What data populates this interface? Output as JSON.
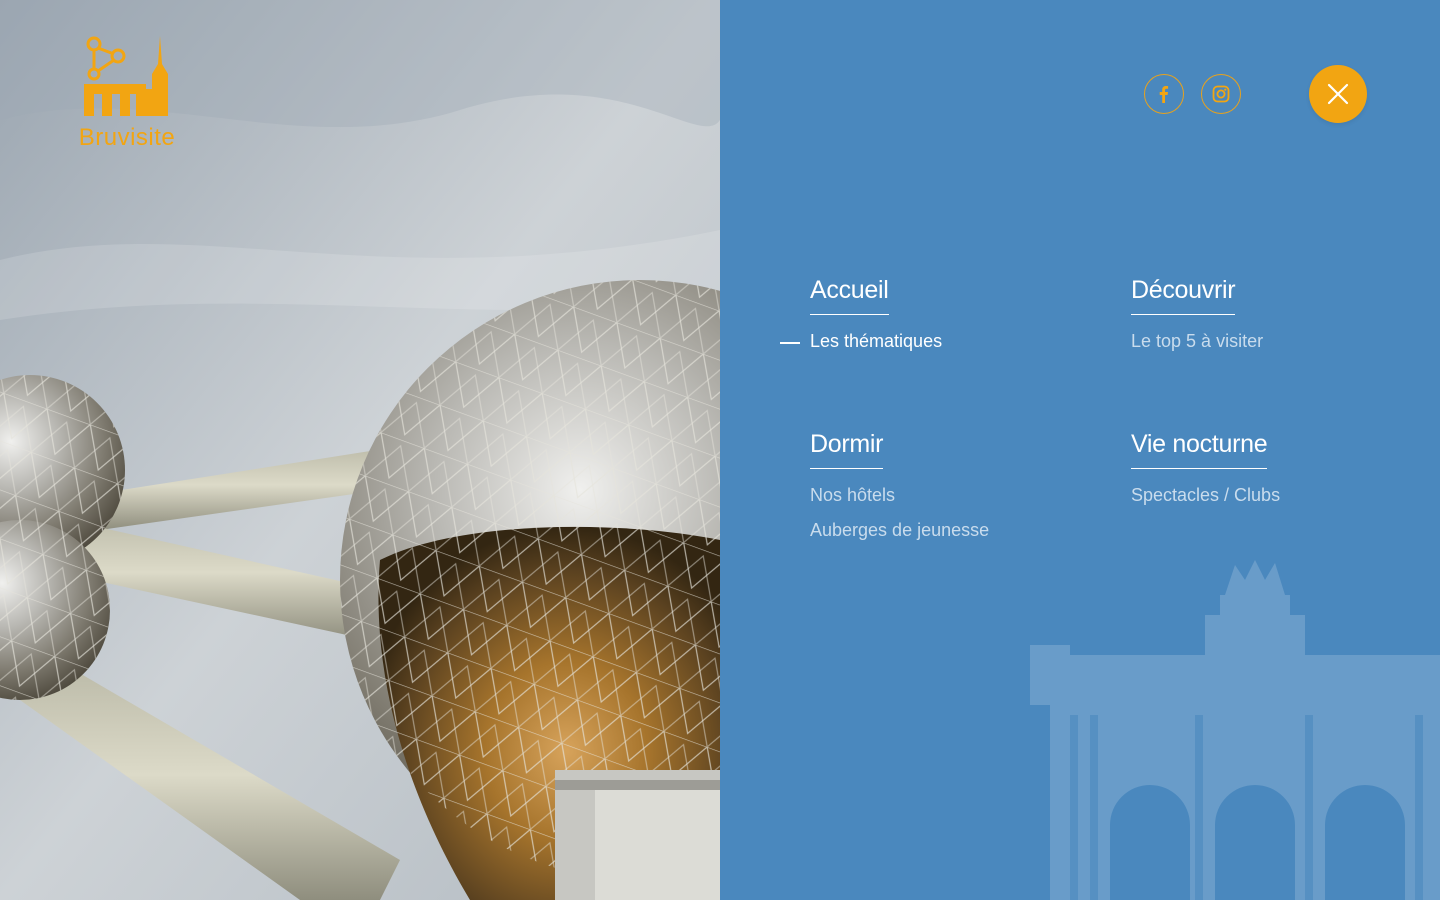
{
  "brand": {
    "name": "Bruvisite"
  },
  "colors": {
    "accent": "#f2a512",
    "panel": "#4a88be",
    "text": "#ffffff",
    "link": "#c9dced"
  },
  "social": [
    {
      "name": "Facebook",
      "icon": "facebook-icon"
    },
    {
      "name": "Instagram",
      "icon": "instagram-icon"
    }
  ],
  "close": {
    "icon": "close-icon"
  },
  "menu": {
    "columns": [
      {
        "title": "Accueil",
        "links": [
          {
            "label": "Les thématiques",
            "active": true
          }
        ]
      },
      {
        "title": "Découvrir",
        "links": [
          {
            "label": "Le top 5 à visiter"
          }
        ]
      },
      {
        "title": "Dormir",
        "links": [
          {
            "label": "Nos hôtels"
          },
          {
            "label": "Auberges de jeunesse"
          }
        ]
      },
      {
        "title": "Vie nocturne",
        "links": [
          {
            "label": "Spectacles / Clubs"
          }
        ]
      }
    ]
  }
}
